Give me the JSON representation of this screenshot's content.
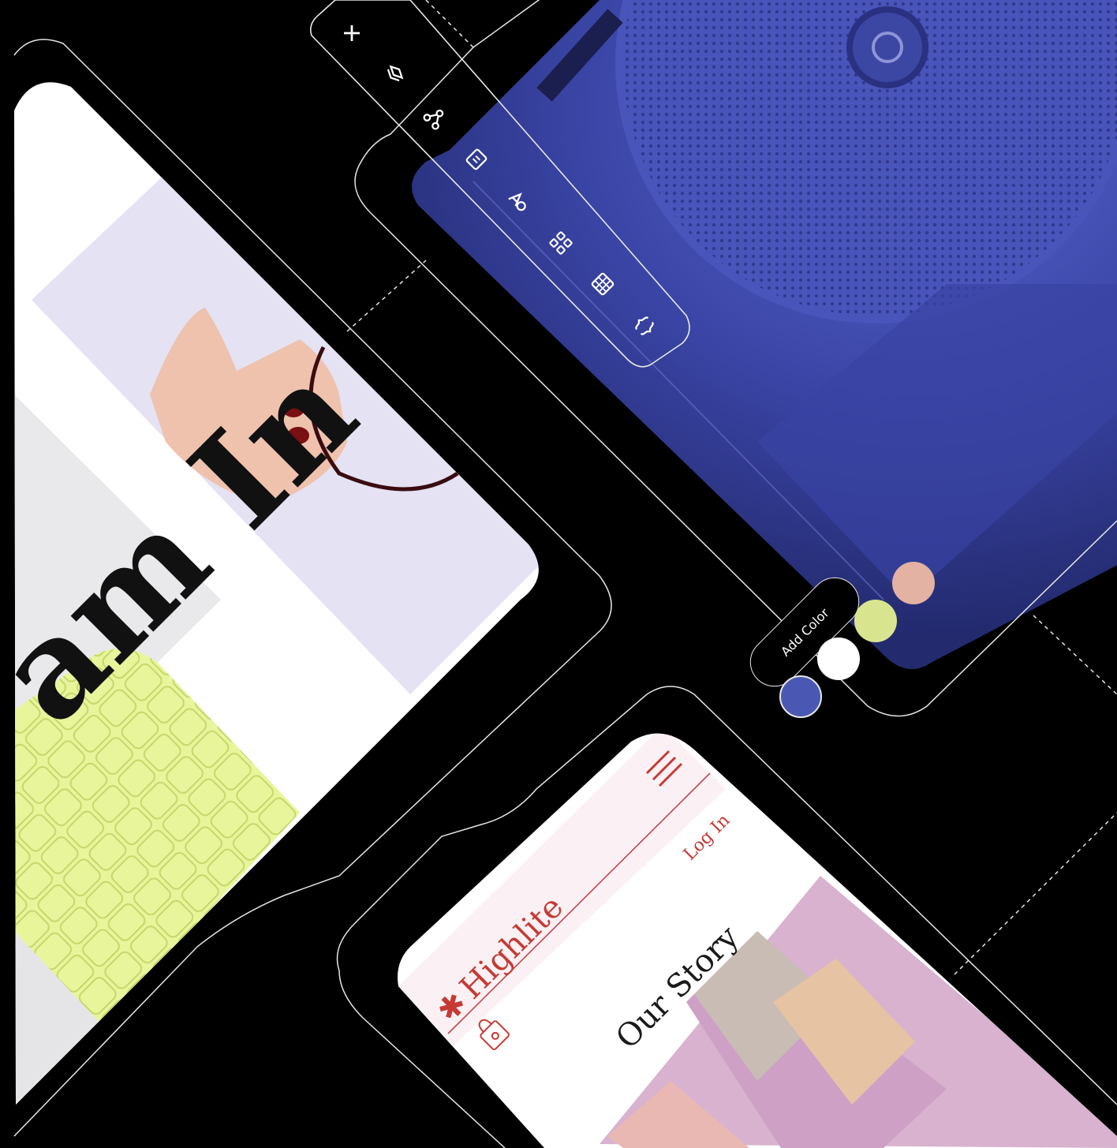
{
  "hero": {
    "headline": "am In"
  },
  "toolbar": {
    "tools": [
      {
        "icon": "add-icon"
      },
      {
        "icon": "layers-icon"
      },
      {
        "icon": "connections-icon"
      },
      {
        "icon": "pages-icon"
      },
      {
        "icon": "fonts-icon"
      },
      {
        "icon": "components-icon"
      },
      {
        "icon": "table-icon"
      },
      {
        "icon": "code-icon"
      }
    ]
  },
  "palette": {
    "add_color_label": "Add Color",
    "swatches": [
      "#4a57b3",
      "#ffffff",
      "#d9e58e",
      "#e3b2a3"
    ]
  },
  "mobile": {
    "brand_name": "Highlite",
    "brand_star": "✱",
    "login_label": "Log In",
    "section_title": "Our Story",
    "accent_color": "#c53a33"
  },
  "colors": {
    "background": "#000000",
    "speaker_blue": "#4550b2",
    "outline": "#e8e8e8"
  }
}
